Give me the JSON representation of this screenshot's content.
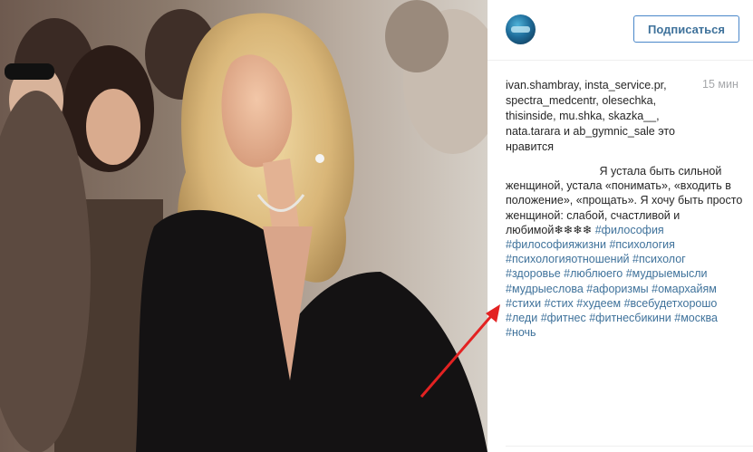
{
  "post": {
    "follow_label": "Подписаться",
    "likes": {
      "users": [
        "ivan.shambray",
        "insta_service.pr",
        "spectra_medcentr",
        "olesechka",
        "thisinside",
        "mu.shka",
        "skazka__",
        "nata.tarara",
        "ab_gymnic_sale"
      ],
      "and_word": "и",
      "suffix": "это нравится"
    },
    "time": "15 мин",
    "caption": {
      "text": "Я устала быть сильной женщиной, устала «понимать», «входить в положение», «прощать». Я хочу быть просто женщиной: слабой, счастливой и любимой❄❄❄❄",
      "hashtags": [
        "#философия",
        "#философияжизни",
        "#психология",
        "#психологияотношений",
        "#психолог",
        "#здоровье",
        "#люблюего",
        "#мудрыемысли",
        "#мудрыеслова",
        "#афоризмы",
        "#омархайям",
        "#стихи",
        "#стих",
        "#худеем",
        "#всебудетхорошо",
        "#леди",
        "#фитнес",
        "#фитнесбикини",
        "#москва",
        "#ночь"
      ]
    }
  },
  "colors": {
    "link": "#3f729b",
    "button_border": "#4a87c9",
    "arrow": "#e32222",
    "muted": "#a5a7aa"
  }
}
